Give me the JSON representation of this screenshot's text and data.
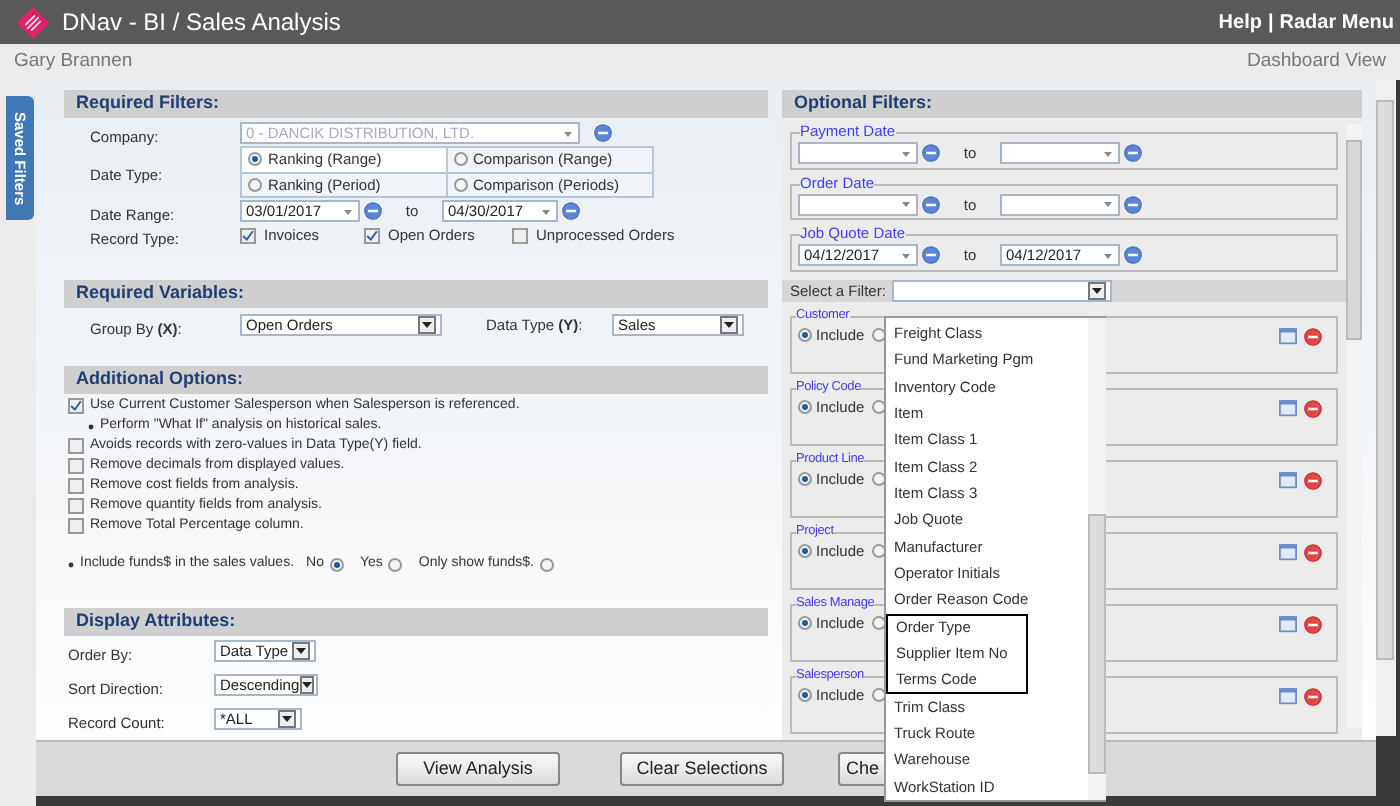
{
  "window": {
    "title": "DNav - BI / Sales Analysis",
    "links": [
      "Help",
      "Radar Menu"
    ],
    "separator": "|"
  },
  "user": "Gary Brannen",
  "view_link": "Dashboard View",
  "side_tab": "Saved Filters",
  "required_filters": {
    "title": "Required Filters:",
    "company": {
      "label": "Company:",
      "value": "0 - DANCIK DISTRIBUTION, LTD.",
      "disabled": true
    },
    "date_type": {
      "label": "Date Type:",
      "options": [
        {
          "label": "Ranking (Range)",
          "selected": true
        },
        {
          "label": "Comparison (Range)",
          "selected": false
        },
        {
          "label": "Ranking (Period)",
          "selected": false
        },
        {
          "label": "Comparison (Periods)",
          "selected": false
        }
      ]
    },
    "date_range": {
      "label": "Date Range:",
      "from": "03/01/2017",
      "to_label": "to",
      "to": "04/30/2017"
    },
    "record_type": {
      "label": "Record Type:",
      "options": [
        {
          "label": "Invoices",
          "checked": true
        },
        {
          "label": "Open Orders",
          "checked": true
        },
        {
          "label": "Unprocessed Orders",
          "checked": false
        }
      ]
    }
  },
  "required_variables": {
    "title": "Required Variables:",
    "group_by": {
      "label": "Group By **(X)**:",
      "value": "Open Orders"
    },
    "data_type": {
      "label": "Data Type **(Y)**:",
      "value": "Sales"
    }
  },
  "additional_options": {
    "title": "Additional Options:",
    "items": [
      {
        "kind": "checkbox",
        "label": "Use Current Customer Salesperson when Salesperson is referenced.",
        "checked": true
      },
      {
        "kind": "bullet",
        "label": "Perform \"What If\" analysis on historical sales."
      },
      {
        "kind": "checkbox",
        "label": "Avoids records with zero-values in Data Type(Y) field.",
        "checked": false
      },
      {
        "kind": "checkbox",
        "label": "Remove decimals from displayed values.",
        "checked": false
      },
      {
        "kind": "checkbox",
        "label": "Remove cost fields from analysis.",
        "checked": false
      },
      {
        "kind": "checkbox",
        "label": "Remove quantity fields from analysis.",
        "checked": false
      },
      {
        "kind": "checkbox",
        "label": "Remove Total Percentage column.",
        "checked": false
      }
    ],
    "funds": {
      "label": "Include funds$ in the sales values.",
      "options": [
        {
          "label": "No",
          "selected": true
        },
        {
          "label": "Yes",
          "selected": false
        },
        {
          "label": "Only show funds$.",
          "selected": false
        }
      ]
    }
  },
  "display_attributes": {
    "title": "Display Attributes:",
    "fields": [
      {
        "label": "Order By:",
        "value": "Data Type"
      },
      {
        "label": "Sort Direction:",
        "value": "Descending"
      },
      {
        "label": "Record Count:",
        "value": "*ALL"
      }
    ]
  },
  "optional_filters": {
    "title": "Optional Filters:",
    "date_ranges": [
      {
        "legend": "Payment Date",
        "to_label": "to"
      },
      {
        "legend": "Order Date",
        "to_label": "to"
      },
      {
        "legend": "Job Quote Date",
        "from": "04/12/2017",
        "to_label": "to",
        "to": "04/12/2017"
      }
    ],
    "select_filter": {
      "label": "Select a Filter:"
    },
    "filters": [
      {
        "legend": "Customer",
        "include_label": "Include",
        "include": true
      },
      {
        "legend": "Policy Code",
        "include_label": "Include",
        "include": true
      },
      {
        "legend": "Product Line",
        "include_label": "Include",
        "include": true
      },
      {
        "legend": "Project",
        "include_label": "Include",
        "include": true
      },
      {
        "legend": "Sales Manage",
        "include_label": "Include",
        "include": true
      },
      {
        "legend": "Salesperson",
        "include_label": "Include",
        "include": true
      }
    ]
  },
  "dropdown": {
    "items": [
      {
        "label": "Freight Class",
        "outlined": false
      },
      {
        "label": "Fund Marketing Pgm",
        "outlined": false
      },
      {
        "label": "Inventory Code",
        "outlined": false
      },
      {
        "label": "Item",
        "outlined": false
      },
      {
        "label": "Item Class 1",
        "outlined": false
      },
      {
        "label": "Item Class 2",
        "outlined": false
      },
      {
        "label": "Item Class 3",
        "outlined": false
      },
      {
        "label": "Job Quote",
        "outlined": false
      },
      {
        "label": "Manufacturer",
        "outlined": false
      },
      {
        "label": "Operator Initials",
        "outlined": false
      },
      {
        "label": "Order Reason Code",
        "outlined": false
      },
      {
        "label": "Order Type",
        "outlined": true
      },
      {
        "label": "Supplier Item No",
        "outlined": true
      },
      {
        "label": "Terms Code",
        "outlined": true
      },
      {
        "label": "Trim Class",
        "outlined": false
      },
      {
        "label": "Truck Route",
        "outlined": false
      },
      {
        "label": "Warehouse",
        "outlined": false
      },
      {
        "label": "WorkStation ID",
        "outlined": false
      }
    ]
  },
  "buttons": [
    "View Analysis",
    "Clear Selections",
    "Che"
  ]
}
